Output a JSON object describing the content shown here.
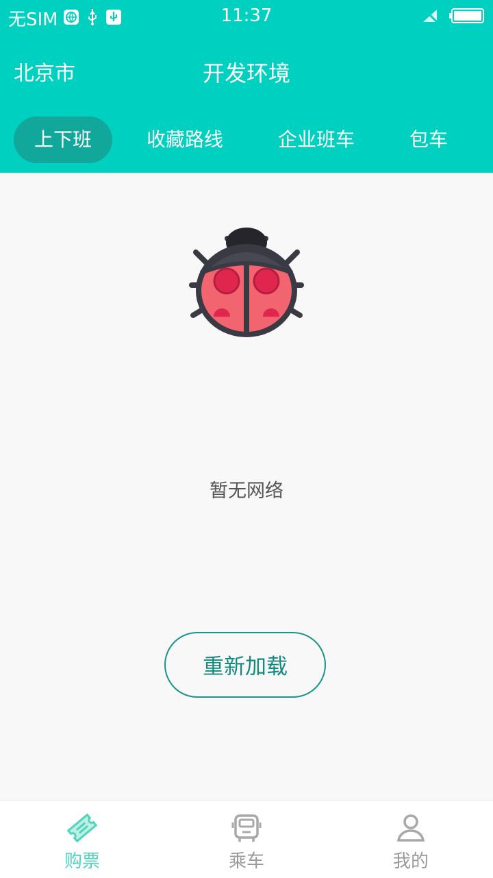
{
  "status": {
    "carrier": "无SIM",
    "time": "11:37"
  },
  "header": {
    "city": "北京市",
    "env": "开发环境"
  },
  "tabs": [
    {
      "label": "上下班",
      "active": true
    },
    {
      "label": "收藏路线",
      "active": false
    },
    {
      "label": "企业班车",
      "active": false
    },
    {
      "label": "包车",
      "active": false
    }
  ],
  "main": {
    "empty_message": "暂无网络",
    "reload_label": "重新加载"
  },
  "bottom_nav": [
    {
      "label": "购票",
      "icon": "ticket-icon",
      "active": true
    },
    {
      "label": "乘车",
      "icon": "bus-icon",
      "active": false
    },
    {
      "label": "我的",
      "icon": "user-icon",
      "active": false
    }
  ],
  "colors": {
    "brand": "#00d0c0",
    "tab_active": "#11a89b",
    "nav_active": "#4fd4bf",
    "nav_inactive": "#999999",
    "button": "#18948a"
  }
}
